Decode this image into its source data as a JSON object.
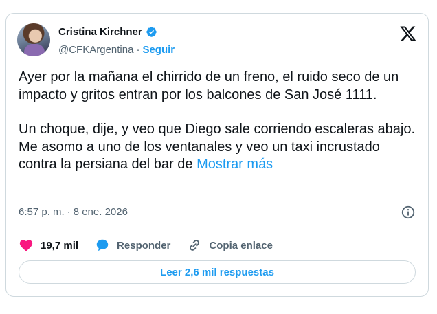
{
  "author": {
    "name": "Cristina Kirchner",
    "handle": "@CFKArgentina",
    "separator": "·",
    "follow_label": "Seguir"
  },
  "tweet": {
    "paragraphs": [
      "Ayer por la mañana el chirrido de un freno, el ruido seco de un impacto y gritos entran por los balcones de San José 1111.",
      "Un choque, dije, y veo que Diego sale corriendo escaleras abajo. Me asomo a uno de los ventanales y veo un taxi incrustado contra la persiana del bar de"
    ],
    "show_more": "Mostrar más",
    "time": "6:57 p. m.",
    "date_separator": "·",
    "date": "8 ene. 2026"
  },
  "actions": {
    "likes": "19,7 mil",
    "reply_label": "Responder",
    "copy_link_label": "Copia enlace",
    "read_replies": "Leer 2,6 mil respuestas"
  },
  "colors": {
    "accent": "#1d9bf0",
    "like": "#f91880",
    "muted": "#536471",
    "border": "#cfd9de"
  }
}
